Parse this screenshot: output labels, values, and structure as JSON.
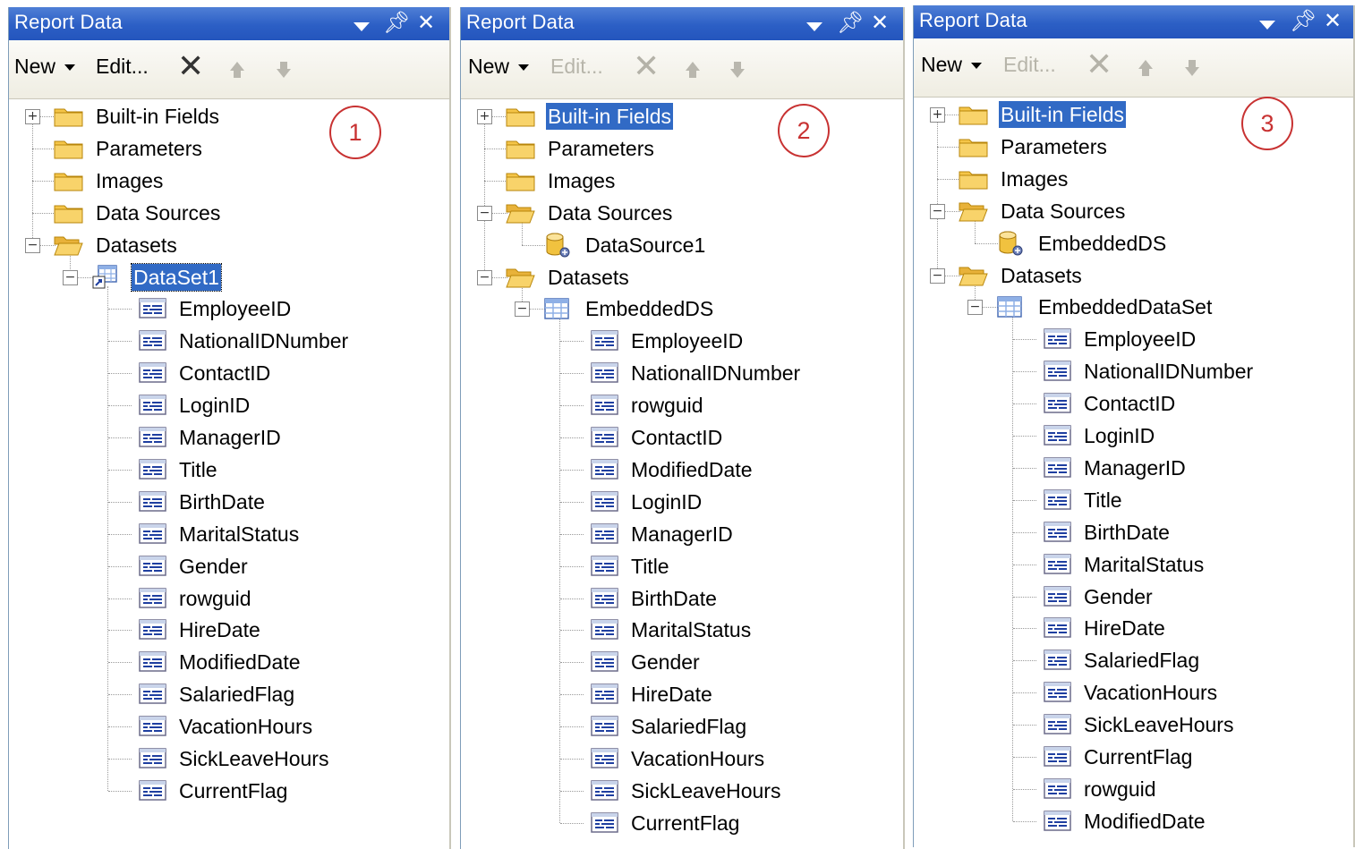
{
  "panels": [
    {
      "title": "Report Data",
      "toolbar": {
        "new": "New",
        "edit": "Edit...",
        "edit_enabled": true
      },
      "callout": "1",
      "tree": [
        {
          "label": "Built-in Fields",
          "type": "folder",
          "level": 0,
          "expander": "+"
        },
        {
          "label": "Parameters",
          "type": "folder",
          "level": 0
        },
        {
          "label": "Images",
          "type": "folder",
          "level": 0
        },
        {
          "label": "Data Sources",
          "type": "folder",
          "level": 0
        },
        {
          "label": "Datasets",
          "type": "folder-open",
          "level": 0,
          "expander": "-"
        },
        {
          "label": "DataSet1",
          "type": "dataset-shared",
          "level": 1,
          "expander": "-",
          "selected": true
        },
        {
          "label": "EmployeeID",
          "type": "field",
          "level": 2
        },
        {
          "label": "NationalIDNumber",
          "type": "field",
          "level": 2
        },
        {
          "label": "ContactID",
          "type": "field",
          "level": 2
        },
        {
          "label": "LoginID",
          "type": "field",
          "level": 2
        },
        {
          "label": "ManagerID",
          "type": "field",
          "level": 2
        },
        {
          "label": "Title",
          "type": "field",
          "level": 2
        },
        {
          "label": "BirthDate",
          "type": "field",
          "level": 2
        },
        {
          "label": "MaritalStatus",
          "type": "field",
          "level": 2
        },
        {
          "label": "Gender",
          "type": "field",
          "level": 2
        },
        {
          "label": "rowguid",
          "type": "field",
          "level": 2
        },
        {
          "label": "HireDate",
          "type": "field",
          "level": 2
        },
        {
          "label": "ModifiedDate",
          "type": "field",
          "level": 2
        },
        {
          "label": "SalariedFlag",
          "type": "field",
          "level": 2
        },
        {
          "label": "VacationHours",
          "type": "field",
          "level": 2
        },
        {
          "label": "SickLeaveHours",
          "type": "field",
          "level": 2
        },
        {
          "label": "CurrentFlag",
          "type": "field",
          "level": 2
        }
      ]
    },
    {
      "title": "Report Data",
      "toolbar": {
        "new": "New",
        "edit": "Edit...",
        "edit_enabled": false
      },
      "callout": "2",
      "tree": [
        {
          "label": "Built-in Fields",
          "type": "folder",
          "level": 0,
          "expander": "+",
          "selected": true
        },
        {
          "label": "Parameters",
          "type": "folder",
          "level": 0
        },
        {
          "label": "Images",
          "type": "folder",
          "level": 0
        },
        {
          "label": "Data Sources",
          "type": "folder-open",
          "level": 0,
          "expander": "-"
        },
        {
          "label": "DataSource1",
          "type": "datasource",
          "level": 1
        },
        {
          "label": "Datasets",
          "type": "folder-open",
          "level": 0,
          "expander": "-"
        },
        {
          "label": "EmbeddedDS",
          "type": "dataset",
          "level": 1,
          "expander": "-"
        },
        {
          "label": "EmployeeID",
          "type": "field",
          "level": 2
        },
        {
          "label": "NationalIDNumber",
          "type": "field",
          "level": 2
        },
        {
          "label": "rowguid",
          "type": "field",
          "level": 2
        },
        {
          "label": "ContactID",
          "type": "field",
          "level": 2
        },
        {
          "label": "ModifiedDate",
          "type": "field",
          "level": 2
        },
        {
          "label": "LoginID",
          "type": "field",
          "level": 2
        },
        {
          "label": "ManagerID",
          "type": "field",
          "level": 2
        },
        {
          "label": "Title",
          "type": "field",
          "level": 2
        },
        {
          "label": "BirthDate",
          "type": "field",
          "level": 2
        },
        {
          "label": "MaritalStatus",
          "type": "field",
          "level": 2
        },
        {
          "label": "Gender",
          "type": "field",
          "level": 2
        },
        {
          "label": "HireDate",
          "type": "field",
          "level": 2
        },
        {
          "label": "SalariedFlag",
          "type": "field",
          "level": 2
        },
        {
          "label": "VacationHours",
          "type": "field",
          "level": 2
        },
        {
          "label": "SickLeaveHours",
          "type": "field",
          "level": 2
        },
        {
          "label": "CurrentFlag",
          "type": "field",
          "level": 2
        }
      ]
    },
    {
      "title": "Report Data",
      "toolbar": {
        "new": "New",
        "edit": "Edit...",
        "edit_enabled": false
      },
      "callout": "3",
      "tree": [
        {
          "label": "Built-in Fields",
          "type": "folder",
          "level": 0,
          "expander": "+",
          "selected": true
        },
        {
          "label": "Parameters",
          "type": "folder",
          "level": 0
        },
        {
          "label": "Images",
          "type": "folder",
          "level": 0
        },
        {
          "label": "Data Sources",
          "type": "folder-open",
          "level": 0,
          "expander": "-"
        },
        {
          "label": "EmbeddedDS",
          "type": "datasource",
          "level": 1
        },
        {
          "label": "Datasets",
          "type": "folder-open",
          "level": 0,
          "expander": "-"
        },
        {
          "label": "EmbeddedDataSet",
          "type": "dataset",
          "level": 1,
          "expander": "-"
        },
        {
          "label": "EmployeeID",
          "type": "field",
          "level": 2
        },
        {
          "label": "NationalIDNumber",
          "type": "field",
          "level": 2
        },
        {
          "label": "ContactID",
          "type": "field",
          "level": 2
        },
        {
          "label": "LoginID",
          "type": "field",
          "level": 2
        },
        {
          "label": "ManagerID",
          "type": "field",
          "level": 2
        },
        {
          "label": "Title",
          "type": "field",
          "level": 2
        },
        {
          "label": "BirthDate",
          "type": "field",
          "level": 2
        },
        {
          "label": "MaritalStatus",
          "type": "field",
          "level": 2
        },
        {
          "label": "Gender",
          "type": "field",
          "level": 2
        },
        {
          "label": "HireDate",
          "type": "field",
          "level": 2
        },
        {
          "label": "SalariedFlag",
          "type": "field",
          "level": 2
        },
        {
          "label": "VacationHours",
          "type": "field",
          "level": 2
        },
        {
          "label": "SickLeaveHours",
          "type": "field",
          "level": 2
        },
        {
          "label": "CurrentFlag",
          "type": "field",
          "level": 2
        },
        {
          "label": "rowguid",
          "type": "field",
          "level": 2
        },
        {
          "label": "ModifiedDate",
          "type": "field",
          "level": 2
        }
      ]
    }
  ],
  "icons": {
    "folder": "folder-icon",
    "folder-open": "folder-open-icon",
    "field": "field-icon",
    "dataset": "dataset-icon",
    "dataset-shared": "shared-dataset-icon",
    "datasource": "data-source-icon",
    "close": "close-icon",
    "pin": "pin-icon",
    "dropdown": "dropdown-arrow-icon",
    "delete": "delete-icon",
    "move_up": "move-up-icon",
    "move_down": "move-down-icon"
  },
  "colors": {
    "titlebar": "#2c5fc5",
    "selection": "#316ac5",
    "callout": "#c83232",
    "folder": "#f5c548"
  }
}
